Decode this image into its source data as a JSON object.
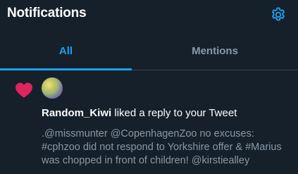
{
  "header": {
    "title": "Notifications",
    "settings_icon": "gear-icon"
  },
  "tabs": [
    {
      "label": "All",
      "active": true
    },
    {
      "label": "Mentions",
      "active": false
    }
  ],
  "notification": {
    "icon": "heart-icon",
    "user": "Random_Kiwi",
    "action": " liked a reply to your Tweet",
    "tweet_lines": [
      ".@missmunter @CopenhagenZoo no excuses:",
      "#cphzoo did not respond to Yorkshire offer & #Marius",
      " was chopped in front of children! @kirstiealley"
    ]
  },
  "colors": {
    "background": "#15202b",
    "accent": "#1da1f2",
    "like": "#e0245e",
    "secondary_text": "#8899a6"
  }
}
